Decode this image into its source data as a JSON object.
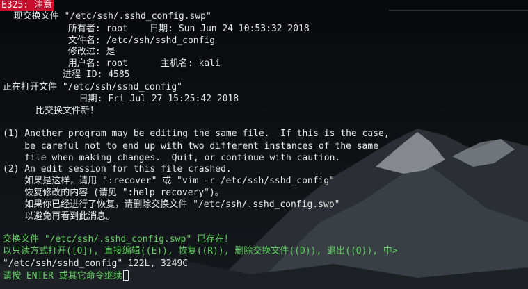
{
  "error_code": "E325: 注意",
  "lines": {
    "l1": "  现交换文件 \"/etc/ssh/.sshd_config.swp\"",
    "l2": "            所有者: root    日期: Sun Jun 24 10:53:32 2018",
    "l3": "            文件名: /etc/ssh/sshd_config",
    "l4": "            修改过: 是",
    "l5": "            用户名: root      主机名: kali",
    "l6": "           进程 ID: 4585",
    "l7": "正在打开文件 \"/etc/ssh/sshd_config\"",
    "l8": "              日期: Fri Jul 27 15:25:42 2018",
    "l9": "      比交换文件新！",
    "l10": "(1) Another program may be editing the same file.  If this is the case,",
    "l11": "    be careful not to end up with two different instances of the same",
    "l12": "    file when making changes.  Quit, or continue with caution.",
    "l13": "(2) An edit session for this file crashed.",
    "l14": "    如果是这样，请用 \":recover\" 或 \"vim -r /etc/ssh/sshd_config\"",
    "l15": "    恢复修改的内容 (请见 \":help recovery\")。",
    "l16": "    如果你已经进行了恢复，请删除交换文件 \"/etc/ssh/.sshd_config.swp\"",
    "l17": "    以避免再看到此消息。",
    "l18": "交换文件 \"/etc/ssh/.sshd_config.swp\" 已存在！",
    "l19": "以只读方式打开([O]), 直接编辑((E)), 恢复((R)), 删除交换文件((D)), 退出((Q)), 中>",
    "l20": "\"/etc/ssh/sshd_config\" 122L, 3249C",
    "l21": "请按 ENTER 或其它命令继续"
  },
  "colors": {
    "warning_bg": "#c8102e",
    "prompt_green": "#5ed35e",
    "text": "#e8e8e8"
  }
}
